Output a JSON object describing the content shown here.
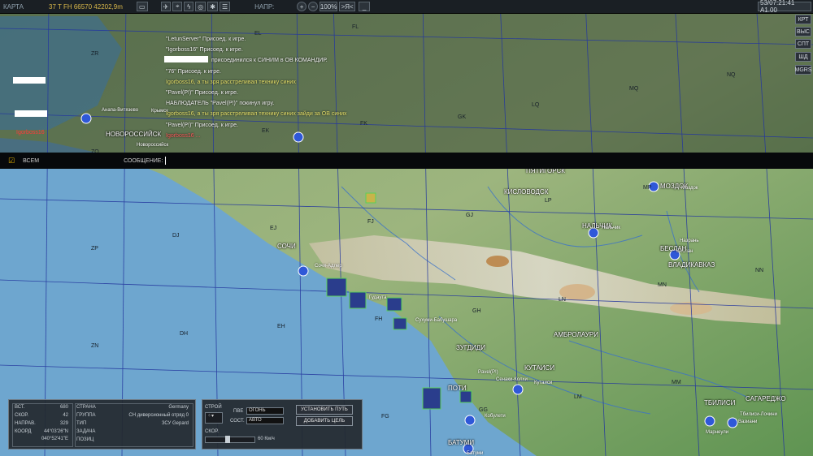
{
  "topbar": {
    "title": "КАРТА",
    "coord": "37 T FH 66570 42202,9m",
    "heading_label": "НАПР:",
    "zoom": "100%",
    "zoom_btn": ">Я<",
    "clock": "53/07:21:41 A1.00"
  },
  "side_buttons": [
    "КРТ",
    "ВЫС",
    "СПТ",
    "ШД",
    "MGRS"
  ],
  "chat": [
    {
      "text": "\"LetunServer\" Присоед. к игре.",
      "cls": ""
    },
    {
      "text": "\"Igorboss16\" Присоед. к игре.",
      "cls": ""
    },
    {
      "text": "присоединился к СИНИМ в ОВ КОМАНДИР.",
      "cls": ""
    },
    {
      "text": "\"76\" Присоед. к игре.",
      "cls": ""
    },
    {
      "text": "Igorboss16, а ты зря расстреливал технику синих",
      "cls": "y"
    },
    {
      "text": "\"Pavel(P!)\" Присоед. к игре.",
      "cls": ""
    },
    {
      "text": "НАБЛЮДАТЕЛЬ \"Pavel(P!)\" покинул игру.",
      "cls": ""
    },
    {
      "text": "Igorboss16, а ты зря расстреливал технику синих зайди за ОВ синих",
      "cls": "y"
    },
    {
      "text": "\"Pavel(P!)\" Присоед. к игре.",
      "cls": ""
    },
    {
      "text": "Igorboss16 ...",
      "cls": "r"
    }
  ],
  "left_red_label": "Igorboss16",
  "message_bar": {
    "all_label": "ВСЕМ",
    "message_label": "СООБЩЕНИЕ:"
  },
  "grid_labels": [
    "EL",
    "FL",
    "ZR",
    "MQ",
    "NQ",
    "ZQ",
    "EK",
    "FK",
    "GK",
    "LQ",
    "EJ",
    "FJ",
    "GJ",
    "LP",
    "MP",
    "DJ",
    "ZP",
    "NN",
    "MN",
    "LN",
    "GH",
    "FH",
    "EH",
    "DH",
    "ZN",
    "MM",
    "LM",
    "GG",
    "FG"
  ],
  "cities": [
    "НОВОРОССИЙСК",
    "Новороссийск",
    "Анапа-Витязево",
    "Крымск",
    "ПЯТИГОРСК",
    "КИСЛОВОДСК",
    "МОЗДОК",
    "Моздок",
    "НАЛЬЧИК",
    "Нальчик",
    "СОЧИ",
    "Сочи-Адлер",
    "Гудаута",
    "Сухуми-Бабушара",
    "Беслан",
    "Назрань",
    "ВЛАДИКАВКАЗ",
    "БЕСЛАН",
    "АМБРОЛАУРИ",
    "ЗУГДИДИ",
    "КУТАИСИ",
    "Кутаиси",
    "Сенаки-Колхи",
    "Кобулети",
    "Pavel(P!)",
    "ПОТИ",
    "БАТУМИ",
    "Батуми",
    "ТБИЛИСИ",
    "САГАРЕДЖО",
    "Тбилиси-Лочини",
    "Вазиани",
    "Марнеули"
  ],
  "info_panel": {
    "alt_label": "ВСТ.",
    "alt_value": "680",
    "speed_label": "СКОР.",
    "speed_value": "42",
    "dir_label": "НАПРАВ.",
    "dir_value": "329",
    "coord_label": "КООРД",
    "coord_lat": "44°03'26\"N",
    "coord_lon": "040°52'41\"E",
    "country_label": "СТРАНА",
    "country_value": "Germany",
    "group_label": "ГРУППА",
    "group_value": "СН диверсионный отряд 0",
    "type_label": "ТИП",
    "type_value": "ЗСУ Gepard",
    "task_label": "ЗАДАЧА",
    "task_value": "",
    "pos_label": "ПОЗИЦ",
    "pos_value": ""
  },
  "control_panel": {
    "formation_label": "СТРОЙ",
    "pve_label": "ПВЕ",
    "pve_value": "ОГОНЬ",
    "sost_label": "СОСТ.",
    "sost_value": "АВТО",
    "speed_label": "СКОР.",
    "speed_value": "60 Км/ч",
    "set_path_button": "УСТАНОВИТЬ ПУТЬ",
    "add_target_button": "ДОБАВИТЬ ЦЕЛЬ"
  },
  "colors": {
    "sea": "#6aa0c8",
    "land": "#4f8a4a",
    "panel": "#23282e",
    "grid": "#2a3e9a",
    "unit": "#2f58d8"
  }
}
